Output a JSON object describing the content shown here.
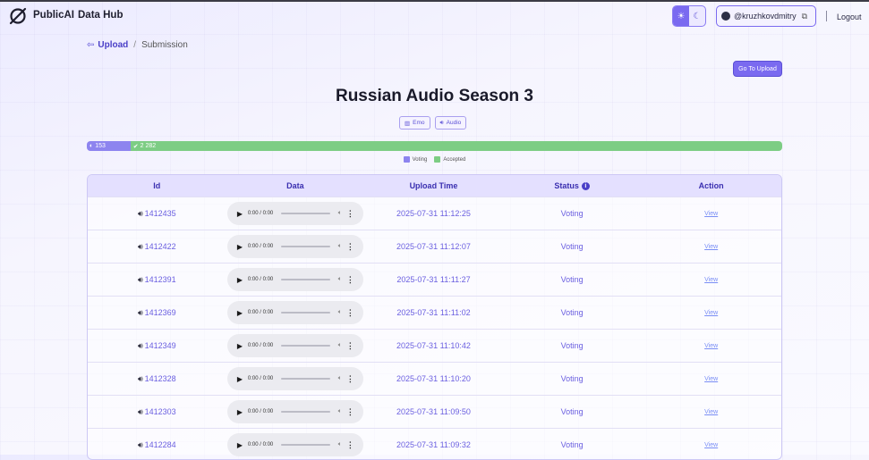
{
  "header": {
    "brand": "PublicAI",
    "hub": "Data Hub",
    "username": "@kruzhkovdmitry",
    "logout": "Logout",
    "sun_icon": "☀",
    "moon_icon": "☾"
  },
  "breadcrumb": {
    "upload": "Upload",
    "current": "Submission"
  },
  "goto_upload": "Go To Upload",
  "title": "Russian Audio Season 3",
  "tags": {
    "emoji_tag": "Emo",
    "audio_tag": "Audio"
  },
  "progress": {
    "voting_count": "153",
    "accepted_count": "2 282",
    "voting_fraction": 0.0628,
    "colors": {
      "voting": "#8d84ef",
      "accepted": "#7dcd84"
    }
  },
  "legend": {
    "voting": "Voting",
    "accepted": "Accepted"
  },
  "table": {
    "headers": {
      "id": "Id",
      "data": "Data",
      "upload_time": "Upload Time",
      "status": "Status",
      "action": "Action"
    },
    "player_time": "0:00 / 0:00",
    "rows": [
      {
        "id": "1412435",
        "time": "2025-07-31 11:12:25",
        "status": "Voting",
        "action": "View"
      },
      {
        "id": "1412422",
        "time": "2025-07-31 11:12:07",
        "status": "Voting",
        "action": "View"
      },
      {
        "id": "1412391",
        "time": "2025-07-31 11:11:27",
        "status": "Voting",
        "action": "View"
      },
      {
        "id": "1412369",
        "time": "2025-07-31 11:11:02",
        "status": "Voting",
        "action": "View"
      },
      {
        "id": "1412349",
        "time": "2025-07-31 11:10:42",
        "status": "Voting",
        "action": "View"
      },
      {
        "id": "1412328",
        "time": "2025-07-31 11:10:20",
        "status": "Voting",
        "action": "View"
      },
      {
        "id": "1412303",
        "time": "2025-07-31 11:09:50",
        "status": "Voting",
        "action": "View"
      },
      {
        "id": "1412284",
        "time": "2025-07-31 11:09:32",
        "status": "Voting",
        "action": "View"
      }
    ]
  }
}
